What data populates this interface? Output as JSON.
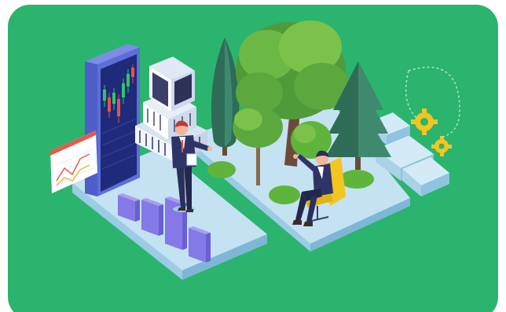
{
  "illustration": {
    "subject": "isometric-office-nature-scene",
    "colors": {
      "card_background": "#2bb46d",
      "platform_top": "#b9dcef",
      "platform_side": "#8fc3df",
      "phone_frame": "#5d6fd6",
      "phone_screen": "#1f2a7a",
      "candle_green": "#34c26a",
      "candle_red": "#e2534a",
      "building": "#e8eef8",
      "building_windows": "#3b3f6b",
      "tree_dark": "#2f6c58",
      "tree_mid": "#4f9b3a",
      "tree_light": "#7cc24a",
      "bush": "#5fb53b",
      "bars": "#8479e6",
      "suit": "#2b2f5c",
      "chair": "#f2c521",
      "gear": "#f2c521",
      "card_chart_line": "#e55a4a"
    },
    "icons": [
      "smartphone-icon",
      "line-chart-icon",
      "bar-chart-icon",
      "building-icon",
      "gear-icon"
    ]
  }
}
